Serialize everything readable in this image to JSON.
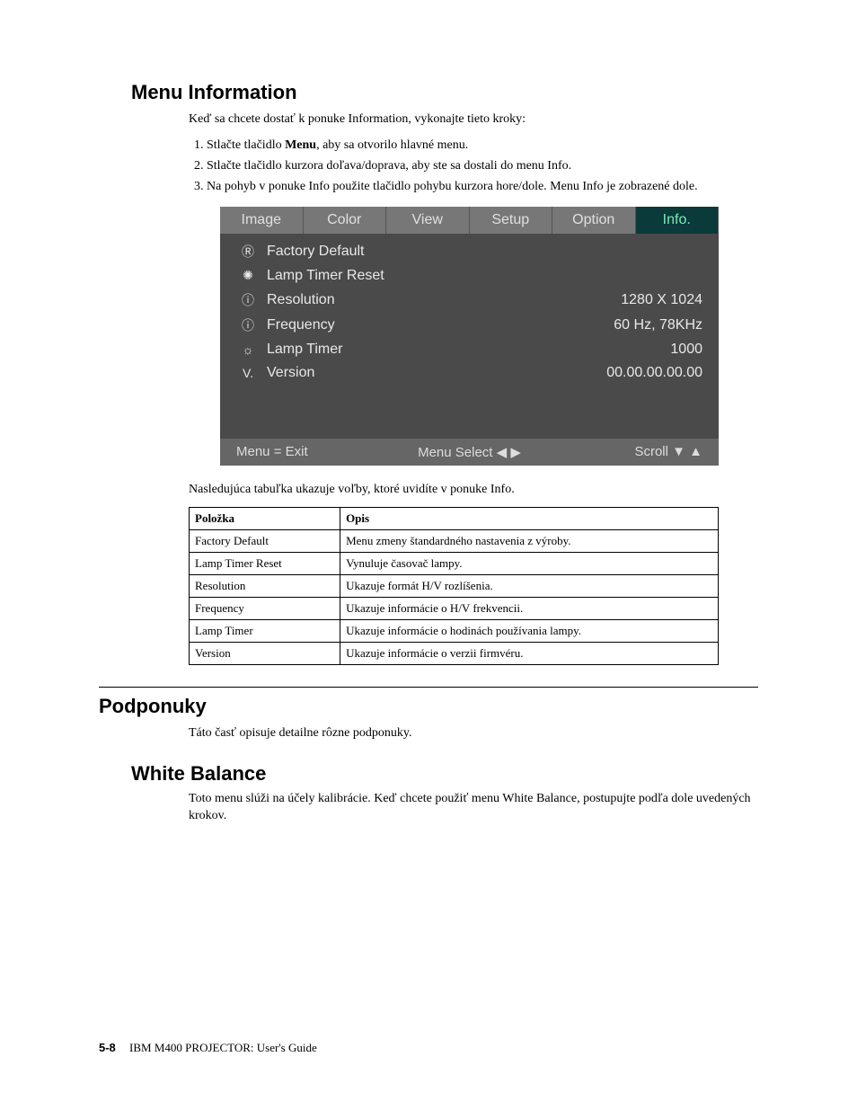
{
  "section1": {
    "title": "Menu Information",
    "intro": "Keď sa chcete dostať k ponuke Information, vykonajte tieto kroky:",
    "steps": [
      {
        "pre": "Stlačte tlačidlo ",
        "bold": "Menu",
        "post": ", aby sa otvorilo hlavné menu."
      },
      {
        "pre": "Stlačte tlačidlo kurzora doľava/doprava, aby ste sa dostali do menu Info.",
        "bold": "",
        "post": ""
      },
      {
        "pre": "Na pohyb v ponuke Info použite tlačidlo pohybu kurzora hore/dole. Menu Info je zobrazené dole.",
        "bold": "",
        "post": ""
      }
    ]
  },
  "osd": {
    "tabs": [
      "Image",
      "Color",
      "View",
      "Setup",
      "Option",
      "Info."
    ],
    "activeTab": 5,
    "rows": [
      {
        "icon": "Ⓡ",
        "label": "Factory Default",
        "value": ""
      },
      {
        "icon": "✺",
        "label": "Lamp Timer Reset",
        "value": ""
      },
      {
        "icon": "ⓘ",
        "label": "Resolution",
        "value": "1280 X 1024"
      },
      {
        "icon": "ⓘ",
        "label": "Frequency",
        "value": "60 Hz, 78KHz"
      },
      {
        "icon": "☼",
        "label": "Lamp Timer",
        "value": "1000"
      },
      {
        "icon": "V.",
        "label": "Version",
        "value": "00.00.00.00.00"
      }
    ],
    "footer": {
      "left": "Menu = Exit",
      "mid": "Menu Select ◀ ▶",
      "right": "Scroll ▼ ▲"
    }
  },
  "tableIntro": "Nasledujúca tabuľka ukazuje voľby, ktoré uvidíte v ponuke Info.",
  "table": {
    "headers": [
      "Položka",
      "Opis"
    ],
    "rows": [
      [
        "Factory Default",
        "Menu zmeny štandardného nastavenia z výroby."
      ],
      [
        "Lamp Timer Reset",
        "Vynuluje časovač lampy."
      ],
      [
        "Resolution",
        "Ukazuje formát H/V rozlíšenia."
      ],
      [
        "Frequency",
        "Ukazuje informácie o H/V frekvencii."
      ],
      [
        "Lamp Timer",
        "Ukazuje informácie o hodinách používania lampy."
      ],
      [
        "Version",
        "Ukazuje informácie o verzii firmvéru."
      ]
    ]
  },
  "section2": {
    "title": "Podponuky",
    "intro": "Táto časť opisuje detailne rôzne podponuky.",
    "sub": {
      "title": "White Balance",
      "intro": "Toto menu slúži na účely kalibrácie. Keď chcete použiť menu White Balance, postupujte podľa dole uvedených krokov."
    }
  },
  "footer": {
    "pagenum": "5-8",
    "title": "IBM M400 PROJECTOR: User's Guide"
  }
}
